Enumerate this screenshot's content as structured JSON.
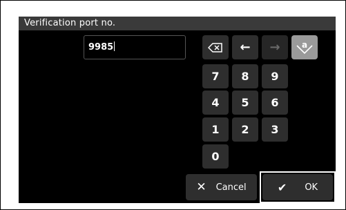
{
  "dialog": {
    "title": "Verification port no.",
    "input_value": "9985"
  },
  "keypad": {
    "backspace_icon": "backspace-icon",
    "left_icon": "arrow-left-icon",
    "right_icon": "arrow-right-icon",
    "case_toggle_icon": "lowercase-toggle-icon",
    "case_toggle_glyph": "a",
    "left_glyph": "←",
    "right_glyph": "→",
    "digits": [
      "7",
      "8",
      "9",
      "4",
      "5",
      "6",
      "1",
      "2",
      "3",
      "0"
    ]
  },
  "actions": {
    "cancel_label": "Cancel",
    "ok_label": "OK",
    "cancel_glyph": "✕",
    "ok_glyph": "✔"
  },
  "colors": {
    "panel": "#000000",
    "title_bar": "#3a3a3a",
    "key": "#2e2e2e",
    "highlight": "#9a9a9a"
  }
}
